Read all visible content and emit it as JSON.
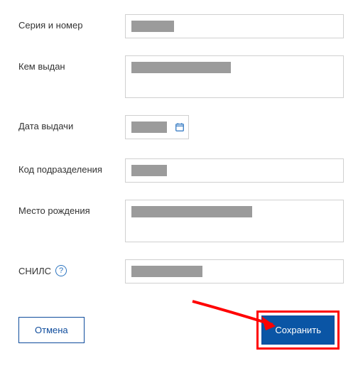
{
  "fields": {
    "series_number": {
      "label": "Серия и номер",
      "value": ""
    },
    "issued_by": {
      "label": "Кем выдан",
      "value": ""
    },
    "issue_date": {
      "label": "Дата выдачи",
      "value": ""
    },
    "dept_code": {
      "label": "Код подразделения",
      "value": ""
    },
    "birthplace": {
      "label": "Место рождения",
      "value": ""
    },
    "snils": {
      "label": "СНИЛС",
      "value": ""
    }
  },
  "buttons": {
    "cancel": "Отмена",
    "save": "Сохранить"
  },
  "icons": {
    "help": "?",
    "calendar": "📅"
  }
}
